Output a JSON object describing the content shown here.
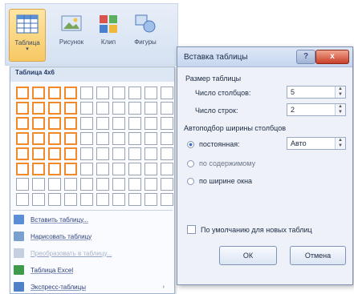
{
  "ribbon": {
    "buttons": [
      {
        "label": "Таблица",
        "icon": "table-icon",
        "active": true
      },
      {
        "label": "Рисунок",
        "icon": "picture-icon"
      },
      {
        "label": "Клип",
        "icon": "clipart-icon"
      },
      {
        "label": "Фигуры",
        "icon": "shapes-icon"
      }
    ]
  },
  "dropdown": {
    "header": "Таблица 4x6",
    "grid": {
      "rows": 8,
      "cols": 10,
      "sel_rows": 6,
      "sel_cols": 4
    },
    "items": [
      {
        "label": "Вставить таблицу...",
        "icon": "insert-table-icon",
        "enabled": true
      },
      {
        "label": "Нарисовать таблицу",
        "icon": "draw-table-icon",
        "enabled": true
      },
      {
        "label": "Преобразовать в таблицу...",
        "icon": "convert-table-icon",
        "enabled": false
      },
      {
        "label": "Таблица Excel",
        "icon": "excel-table-icon",
        "enabled": true
      },
      {
        "label": "Экспресс-таблицы",
        "icon": "quick-tables-icon",
        "enabled": true,
        "submenu_arrow": "›"
      }
    ]
  },
  "dialog": {
    "title": "Вставка таблицы",
    "help_label": "?",
    "close_label": "x",
    "size_section": "Размер таблицы",
    "columns_label": "Число столбцов:",
    "columns_value": "5",
    "rows_label": "Число строк:",
    "rows_value": "2",
    "autofit_section": "Автоподбор ширины столбцов",
    "autofit_options": [
      {
        "label": "постоянная:",
        "selected": true
      },
      {
        "label": "по содержимому",
        "selected": false
      },
      {
        "label": "по ширине окна",
        "selected": false
      }
    ],
    "fixed_value": "Авто",
    "remember_label": "По умолчанию для новых таблиц",
    "ok_label": "ОК",
    "cancel_label": "Отмена"
  },
  "colors": {
    "accent": "#f08a2a",
    "dialog_bg": "#eef2f8"
  }
}
